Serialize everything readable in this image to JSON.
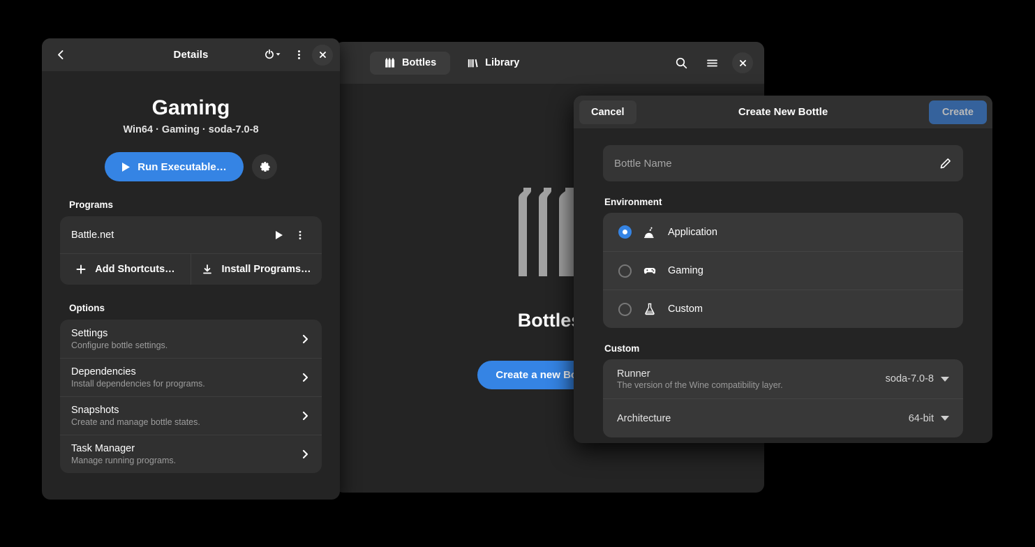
{
  "main_window": {
    "tabs": [
      {
        "label": "Bottles",
        "icon": "bottles-icon",
        "active": true
      },
      {
        "label": "Library",
        "icon": "library-icon",
        "active": false
      }
    ],
    "header_actions": [
      {
        "name": "search-icon",
        "label": "Search"
      },
      {
        "name": "hamburger-menu-icon",
        "label": "Main Menu"
      },
      {
        "name": "close-icon",
        "label": "Close"
      }
    ],
    "empty_state": {
      "icon": "bottles-illustration",
      "title": "Bottles",
      "button_label": "Create a new Bottle…"
    }
  },
  "details_window": {
    "header": {
      "back_icon": "back-arrow-icon",
      "title": "Details",
      "power_icon": "power-icon",
      "power_caret_icon": "chevron-down-icon",
      "overflow_icon": "more-vertical-icon",
      "close_icon": "close-icon"
    },
    "bottle": {
      "name": "Gaming",
      "subtitle": "Win64 · Gaming · soda-7.0-8",
      "run_button": "Run Executable…",
      "run_icon": "play-icon",
      "settings_icon": "gear-icon"
    },
    "programs": {
      "label": "Programs",
      "items": [
        {
          "name": "Battle.net",
          "run_icon": "play-icon",
          "menu_icon": "more-vertical-icon"
        }
      ],
      "actions": [
        {
          "label": "Add Shortcuts…",
          "icon": "plus-icon"
        },
        {
          "label": "Install Programs…",
          "icon": "download-icon"
        }
      ]
    },
    "options": {
      "label": "Options",
      "items": [
        {
          "title": "Settings",
          "subtitle": "Configure bottle settings."
        },
        {
          "title": "Dependencies",
          "subtitle": "Install dependencies for programs."
        },
        {
          "title": "Snapshots",
          "subtitle": "Create and manage bottle states."
        },
        {
          "title": "Task Manager",
          "subtitle": "Manage running programs."
        }
      ]
    }
  },
  "create_dialog": {
    "title": "Create New Bottle",
    "cancel_label": "Cancel",
    "create_label": "Create",
    "name_field": {
      "placeholder": "Bottle Name",
      "value": "",
      "edit_icon": "pencil-icon"
    },
    "environment": {
      "label": "Environment",
      "options": [
        {
          "label": "Application",
          "icon": "application-icon",
          "selected": true
        },
        {
          "label": "Gaming",
          "icon": "gamepad-icon",
          "selected": false
        },
        {
          "label": "Custom",
          "icon": "flask-icon",
          "selected": false
        }
      ]
    },
    "custom": {
      "label": "Custom",
      "rows": [
        {
          "title": "Runner",
          "subtitle": "The version of the Wine compatibility layer.",
          "value": "soda-7.0-8"
        },
        {
          "title": "Architecture",
          "subtitle": "",
          "value": "64-bit"
        }
      ]
    }
  },
  "colors": {
    "accent": "#3584e4",
    "suggested_disabled": "#35629c",
    "window_bg": "#242424",
    "header_bg": "#303030",
    "card_bg": "#303030",
    "dialog_card_bg": "#383838"
  }
}
